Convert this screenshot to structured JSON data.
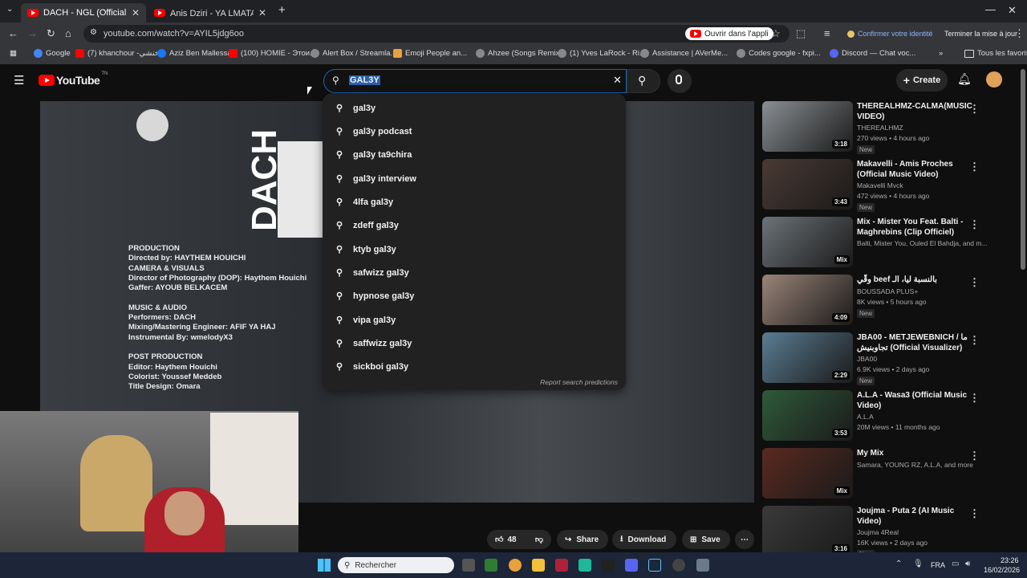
{
  "browser": {
    "tabs": [
      {
        "title": "DACH - NGL (Official Music Vid",
        "active": true
      },
      {
        "title": "Anis Dziri - YA LMATAR / المطر",
        "active": false
      }
    ],
    "url": "youtube.com/watch?v=AYIL5jdg6oo",
    "open_in_app": "Ouvrir dans l'appli",
    "confirm_identity": "Confirmer votre identité",
    "update_button": "Terminer la mise à jour",
    "bookmarks": [
      "Google",
      "(7) khanchour -خنشي...",
      "Aziz Ben Mallessa",
      "(100) HOMIE - Этои...",
      "Alert Box / Streamla...",
      "Emoji People an...",
      "Ahzee (Songs Remix...",
      "(1) Yves LaRock - Ri...",
      "Assistance | AVerMe...",
      "Codes google - fxpi...",
      "Discord — Chat voc...",
      "Tous les favoris"
    ]
  },
  "youtube": {
    "logo": "YouTube",
    "logo_sup": "TN",
    "search_value": "GAL3Y",
    "create_label": "Create",
    "suggestions": [
      "gal3y",
      "gal3y podcast",
      "gal3y ta9chira",
      "gal3y interview",
      "4lfa gal3y",
      "zdeff gal3y",
      "ktyb gal3y",
      "safwizz gal3y",
      "hypnose gal3y",
      "vipa gal3y",
      "saffwizz gal3y",
      "sickboi gal3y"
    ],
    "report_label": "Report search predictions",
    "actions": {
      "likes": "48",
      "share": "Share",
      "download": "Download",
      "save": "Save"
    }
  },
  "video_overlay": {
    "logo_text": "DACH",
    "credits": [
      "PRODUCTION",
      "Directed by: HAYTHEM HOUICHI",
      "",
      "CAMERA & VISUALS",
      "Director of Photography (DOP): Haythem Houichi",
      "Gaffer: AYOUB BELKACEM",
      "",
      "MUSIC & AUDIO",
      "Performers: DACH",
      "Mixing/Mastering Engineer: AFIF YA HAJ",
      "Instrumental By: wmelodyX3",
      "",
      "POST PRODUCTION",
      "Editor: Haythem Houichi",
      "Colorist: Youssef Meddeb",
      "Title Design: Omara"
    ]
  },
  "sidebar": [
    {
      "title": "THEREALHMZ-CALMA(MUSIC VIDEO)",
      "channel": "THEREALHMZ",
      "stats": "270 views • 4 hours ago",
      "badge": "New",
      "duration": "3:18",
      "thumb": "#8a8f93"
    },
    {
      "title": "Makavelli - Amis Proches (Official Music Video)",
      "channel": "Makavelli Mvck",
      "stats": "472 views • 4 hours ago",
      "badge": "New",
      "duration": "3:43",
      "thumb": "#4a3a34"
    },
    {
      "title": "Mix - Mister You Feat. Balti - Maghrebins (Clip Officiel)",
      "channel": "Balti, Mister You, Ouled El Bahdja, and m...",
      "stats": "",
      "badge": "",
      "duration": "Mix",
      "thumb": "#6d7378"
    },
    {
      "title": "وقّي beef بالنسبة ليا، الـ",
      "channel": "BOUSSADA PLUS+",
      "stats": "8K views • 5 hours ago",
      "badge": "New",
      "duration": "4:09",
      "thumb": "#9a8478"
    },
    {
      "title": "JBA00 - METJEWEBNICH / ما تجاوبنيش (Official Visualizer)",
      "channel": "JBA00",
      "stats": "6.9K views • 2 days ago",
      "badge": "New",
      "duration": "2:29",
      "thumb": "#5b7d93"
    },
    {
      "title": "A.L.A - Wasa3 (Official Music Video)",
      "channel": "A.L.A",
      "stats": "20M views • 11 months ago",
      "badge": "",
      "duration": "3:53",
      "thumb": "#2f5a3a"
    },
    {
      "title": "My Mix",
      "channel": "Samara, YOUNG RZ, A.L.A, and more",
      "stats": "",
      "badge": "",
      "duration": "Mix",
      "thumb": "#5a2a20"
    },
    {
      "title": "Joujma - Puta 2 (AI Music Video)",
      "channel": "Joujma 4Real",
      "stats": "16K views • 2 days ago",
      "badge": "New",
      "duration": "3:16",
      "thumb": "#3a3a3a"
    }
  ],
  "taskbar": {
    "search_placeholder": "Rechercher",
    "lang": "FRA",
    "time": "23:26",
    "date": "16/02/2026"
  }
}
